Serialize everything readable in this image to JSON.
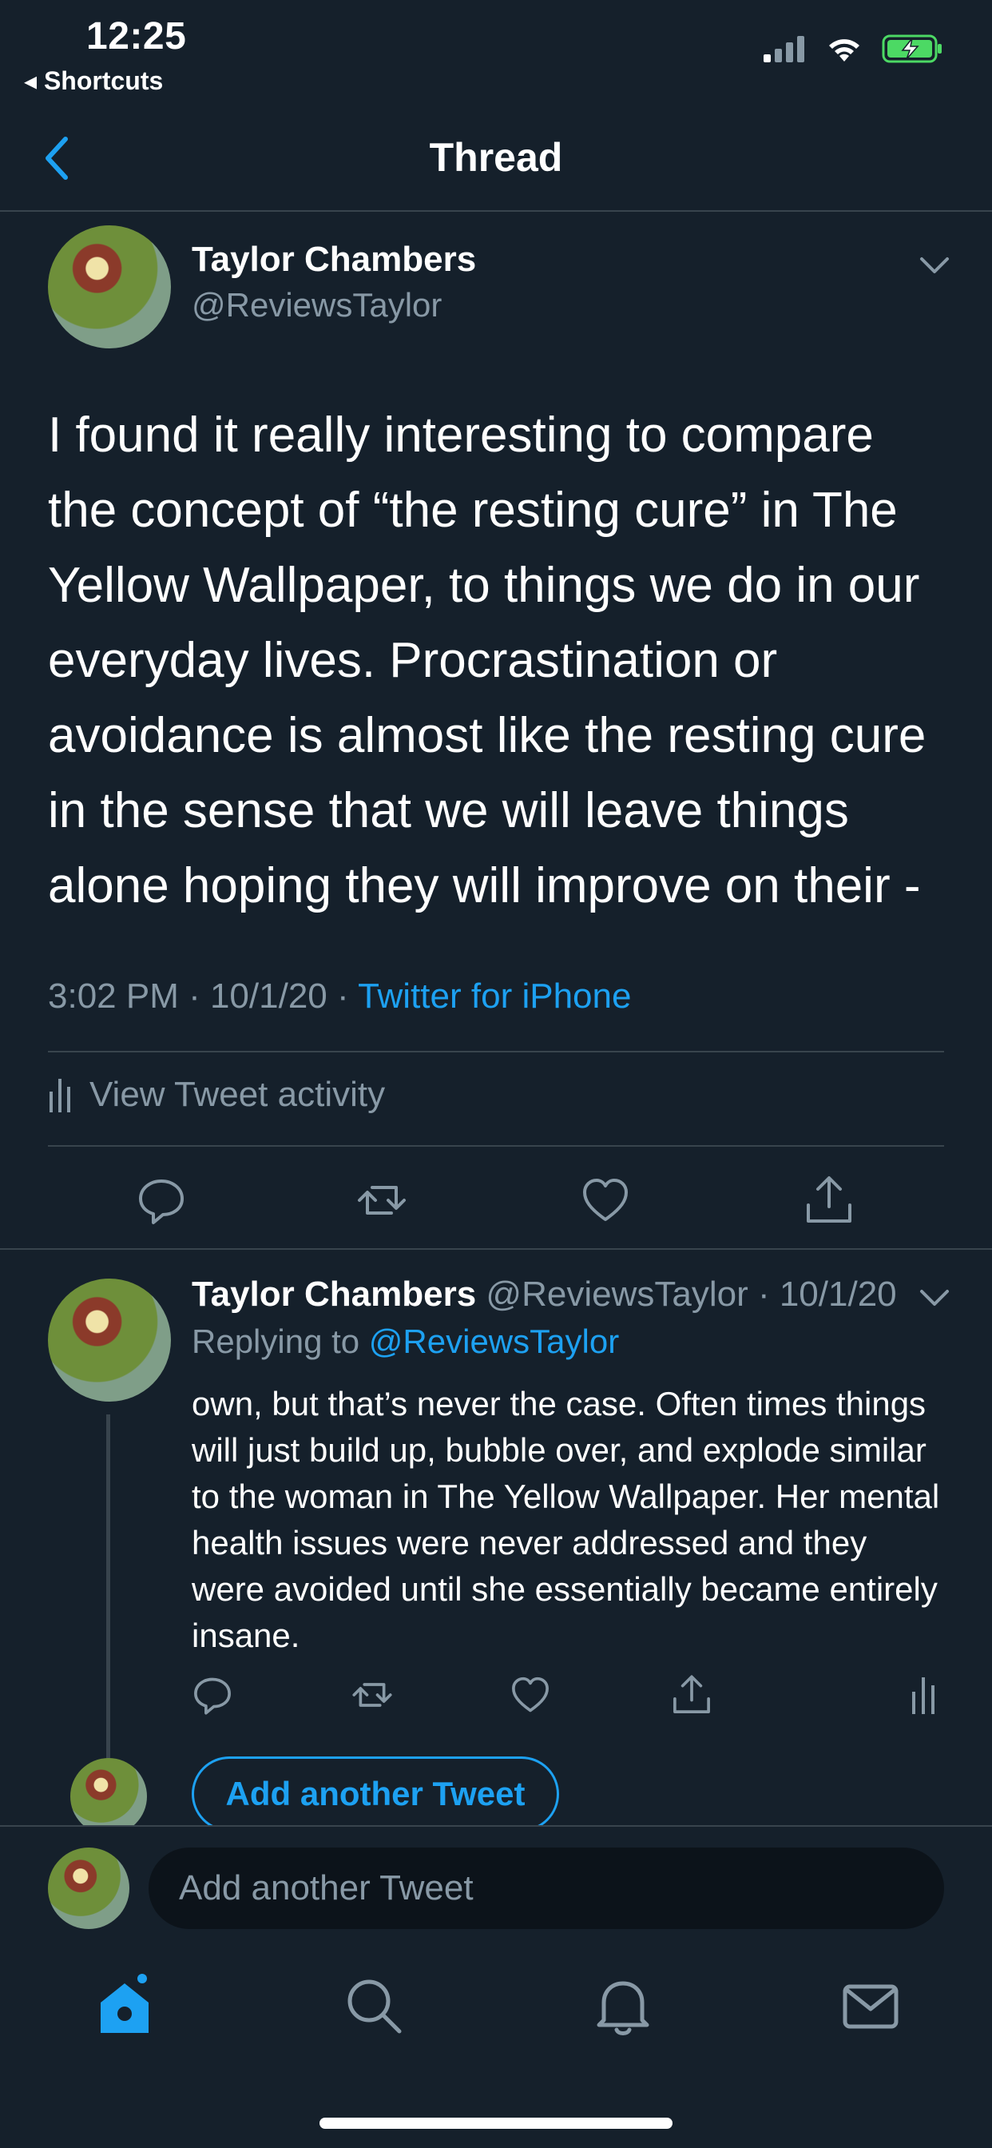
{
  "status_bar": {
    "time": "12:25",
    "back_app": "◂ Shortcuts"
  },
  "header": {
    "title": "Thread"
  },
  "main_tweet": {
    "author_name": "Taylor Chambers",
    "author_handle": "@ReviewsTaylor",
    "text": "I found it really interesting to compare the concept of “the resting cure” in The Yellow Wallpaper, to things we do in our everyday lives. Procrastination or avoidance is almost like the resting cure in the sense that we will leave things alone hoping they will improve on their -",
    "timestamp": "3:02 PM · 10/1/20 · ",
    "source": "Twitter for iPhone",
    "activity_label": "View Tweet activity"
  },
  "reply_tweet": {
    "author_name": "Taylor Chambers",
    "author_handle_date": " @ReviewsTaylor · 10/1/20",
    "replying_prefix": "Replying to ",
    "replying_handle": "@ReviewsTaylor",
    "text": "own, but that’s never the case. Often times things will just build up, bubble over, and explode similar to the woman in The Yellow Wallpaper. Her mental health issues were never addressed and they were avoided until she essentially became entirely insane."
  },
  "thread_add": {
    "button_label": "Add another Tweet"
  },
  "composer": {
    "placeholder": "Add another Tweet"
  },
  "colors": {
    "background": "#15202b",
    "accent": "#1da1f2",
    "muted": "#8899a6",
    "divider": "#38444d",
    "battery": "#4cd964"
  },
  "icons": {
    "tab_bar": [
      "home-icon",
      "search-icon",
      "notifications-icon",
      "messages-icon"
    ],
    "tweet_actions": [
      "reply-icon",
      "retweet-icon",
      "like-icon",
      "share-icon"
    ]
  }
}
